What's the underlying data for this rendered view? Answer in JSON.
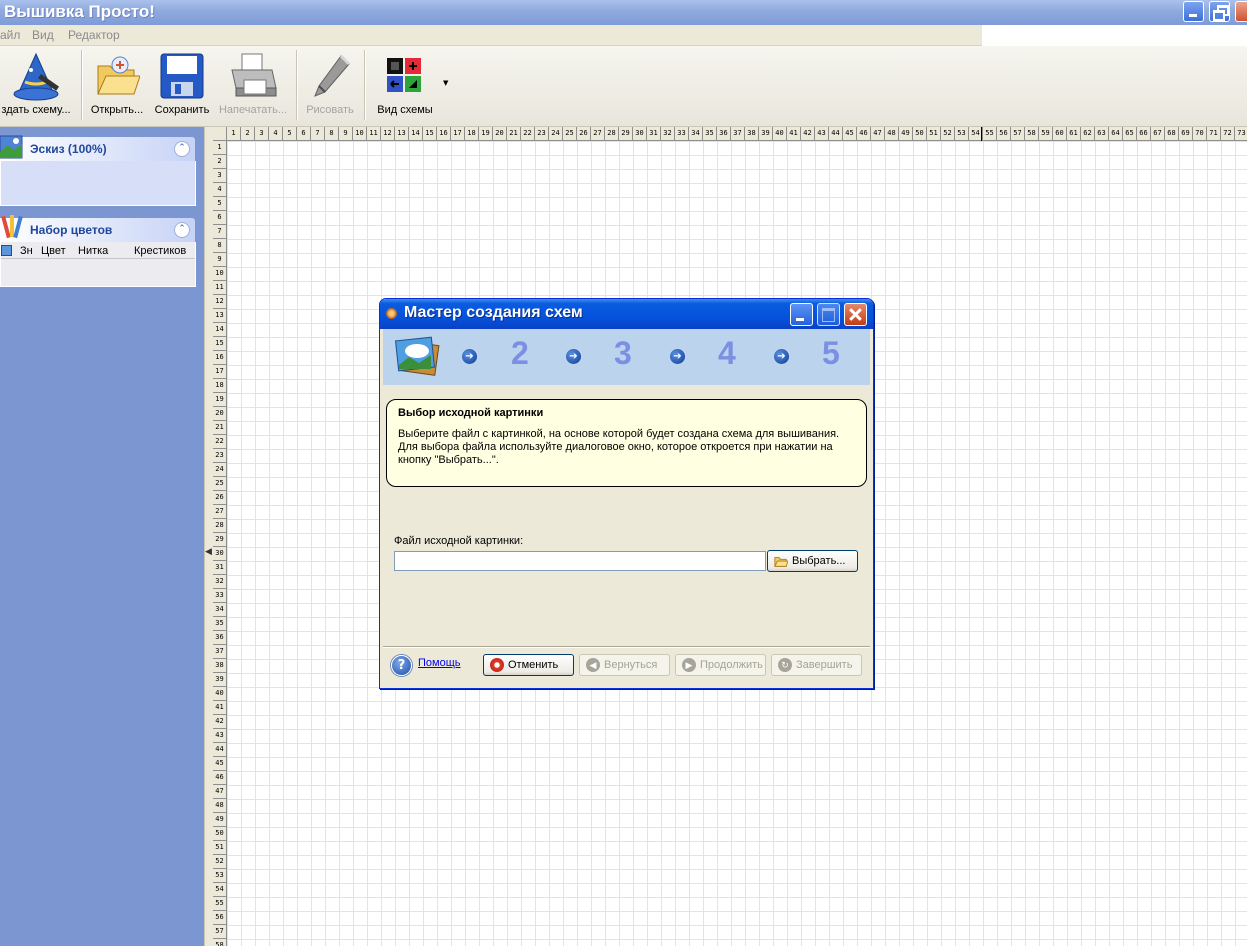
{
  "app": {
    "title": "Вышивка Просто!"
  },
  "menu": {
    "items": [
      "айл",
      "Вид",
      "Редактор"
    ]
  },
  "toolbar": {
    "create_label": "здать схему...",
    "open_label": "Открыть...",
    "save_label": "Сохранить",
    "print_label": "Напечатать...",
    "draw_label": "Рисовать",
    "view_label": "Вид схемы"
  },
  "left_panel": {
    "sketch_title": "Эскиз (100%)",
    "colors_title": "Набор цветов",
    "columns": [
      "Зн",
      "Цвет",
      "Нитка",
      "Крестиков"
    ]
  },
  "canvas": {
    "columns": 75,
    "rows": 58
  },
  "wizard": {
    "title": "Мастер создания схем",
    "steps": [
      "2",
      "3",
      "4",
      "5"
    ],
    "info_title": "Выбор исходной картинки",
    "info_text": "Выберите файл с картинкой, на основе которой будет создана схема для вышивания. Для выбора файла используйте диалоговое окно, которое откроется при нажатии на кнопку \"Выбрать...\".",
    "file_label": "Файл исходной картинки:",
    "file_value": "",
    "browse_label": "Выбрать...",
    "help_label": "Помощь",
    "cancel_label": "Отменить",
    "back_label": "Вернуться",
    "next_label": "Продолжить",
    "finish_label": "Завершить"
  },
  "colors": {
    "titlebar": "#8fa9dd",
    "dialog_title": "#0553dc",
    "panel_bg": "#7b96d1",
    "info_bg": "#ffffe1"
  }
}
